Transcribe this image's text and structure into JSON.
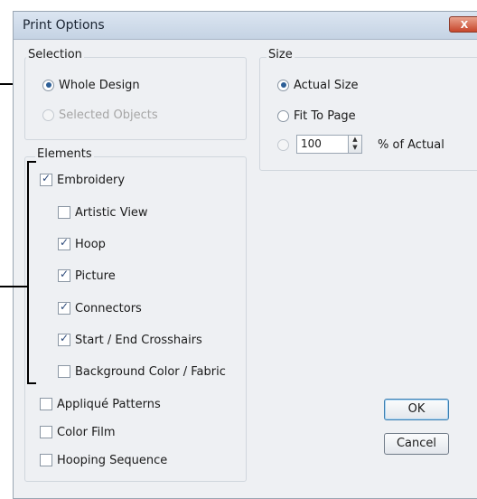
{
  "window": {
    "title": "Print Options",
    "close_label": "X"
  },
  "selection": {
    "label": "Selection",
    "whole_design": "Whole Design",
    "selected_objects": "Selected Objects",
    "selected": "Whole Design"
  },
  "size": {
    "label": "Size",
    "actual_size": "Actual Size",
    "fit_to_page": "Fit To Page",
    "percent_value": "100",
    "percent_label": "% of Actual",
    "selected": "Actual Size"
  },
  "elements": {
    "label": "Elements",
    "items": [
      {
        "label": "Embroidery",
        "checked": true
      },
      {
        "label": "Artistic View",
        "checked": false
      },
      {
        "label": "Hoop",
        "checked": true
      },
      {
        "label": "Picture",
        "checked": true
      },
      {
        "label": "Connectors",
        "checked": true
      },
      {
        "label": "Start / End Crosshairs",
        "checked": true
      },
      {
        "label": "Background Color / Fabric",
        "checked": false
      },
      {
        "label": "Appliqué Patterns",
        "checked": false
      },
      {
        "label": "Color Film",
        "checked": false
      },
      {
        "label": "Hooping Sequence",
        "checked": false
      }
    ]
  },
  "buttons": {
    "ok": "OK",
    "cancel": "Cancel"
  },
  "icons": {
    "close": "close-icon",
    "spin_up": "spin-up-icon",
    "spin_down": "spin-down-icon"
  }
}
